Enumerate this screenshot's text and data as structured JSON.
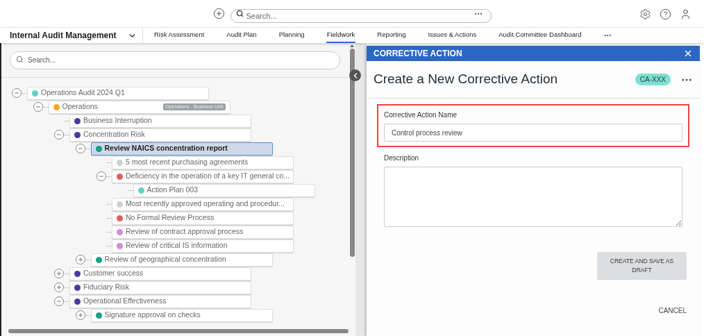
{
  "top_bar": {
    "search": {
      "placeholder": "Search..."
    }
  },
  "app_title": "Internal Audit Management",
  "nav_tabs": [
    {
      "label": "Risk Assessment",
      "selected": false
    },
    {
      "label": "Audit Plan",
      "selected": false
    },
    {
      "label": "Planning",
      "selected": false
    },
    {
      "label": "Fieldwork",
      "selected": true
    },
    {
      "label": "Reporting",
      "selected": false
    },
    {
      "label": "Issues & Actions",
      "selected": false
    },
    {
      "label": "Audit Committee Dashboard",
      "selected": false
    }
  ],
  "tree_search": {
    "placeholder": "Search..."
  },
  "tree": [
    {
      "label": "Operations Audit 2024 Q1",
      "color": "#5fd3c6",
      "expanded": true,
      "selected": false,
      "children": [
        {
          "label": "Operations",
          "color": "#f5a623",
          "expanded": true,
          "selected": false,
          "tag": "Operations - Business Unit",
          "children": [
            {
              "label": "Business Interruption",
              "color": "#4b3a9e",
              "selected": false
            },
            {
              "label": "Concentration Risk",
              "color": "#4b3a9e",
              "expanded": true,
              "selected": false,
              "children": [
                {
                  "label": "Review NAICS concentration report",
                  "color": "#17a085",
                  "expanded": true,
                  "selected": true,
                  "children": [
                    {
                      "label": "5 most recent purchasing agreements",
                      "color": "#d0d0d0",
                      "selected": false
                    },
                    {
                      "label": "Deficiency in the operation of a key IT general co...",
                      "color": "#d9615d",
                      "expanded": true,
                      "selected": false,
                      "children": [
                        {
                          "label": "Action Plan 003",
                          "color": "#5fd3c6",
                          "selected": false
                        }
                      ]
                    },
                    {
                      "label": "Most recently approved operating and procedur...",
                      "color": "#d0d0d0",
                      "selected": false
                    },
                    {
                      "label": "No Formal Review Process",
                      "color": "#d9615d",
                      "selected": false
                    },
                    {
                      "label": "Review of contract approval process",
                      "color": "#d48bd8",
                      "selected": false
                    },
                    {
                      "label": "Review of critical IS information",
                      "color": "#d48bd8",
                      "selected": false
                    }
                  ]
                },
                {
                  "label": "Review of geographical concentration",
                  "color": "#17a085",
                  "expanded": false,
                  "selected": false
                }
              ]
            },
            {
              "label": "Customer success",
              "color": "#4b3a9e",
              "expanded": false,
              "selected": false
            },
            {
              "label": "Fiduciary Risk",
              "color": "#4b3a9e",
              "expanded": false,
              "selected": false
            },
            {
              "label": "Operational Effectiveness",
              "color": "#4b3a9e",
              "expanded": true,
              "selected": false,
              "children": [
                {
                  "label": "Signature approval on checks",
                  "color": "#17a085",
                  "expanded": false,
                  "selected": false
                }
              ]
            }
          ]
        }
      ]
    }
  ],
  "panel": {
    "header": "CORRECTIVE ACTION",
    "title": "Create a New Corrective Action",
    "badge": "CA-XXX",
    "fields": [
      {
        "kind": "text",
        "label": "Corrective Action Name",
        "value": "Control process review",
        "highlighted": true
      },
      {
        "kind": "textarea",
        "label": "Description"
      }
    ],
    "primary_button": "CREATE AND SAVE AS DRAFT",
    "cancel_button": "CANCEL"
  }
}
